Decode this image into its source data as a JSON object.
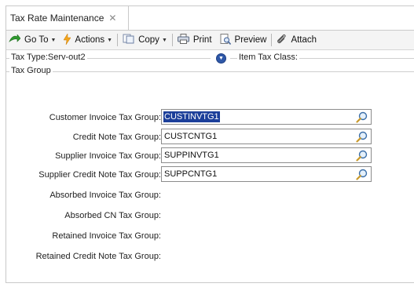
{
  "tab": {
    "title": "Tax Rate Maintenance",
    "close_glyph": "✕"
  },
  "toolbar": {
    "goto_label": "Go To",
    "actions_label": "Actions",
    "copy_label": "Copy",
    "print_label": "Print",
    "preview_label": "Preview",
    "attach_label": "Attach"
  },
  "header": {
    "tax_type_label": "Tax Type:",
    "tax_type_value": "Serv-out2",
    "item_tax_class_label": "Item Tax Class:"
  },
  "tax_group": {
    "section_label": "Tax Group",
    "rows": [
      {
        "label": "Customer Invoice Tax Group:",
        "value": "CUSTINVTG1",
        "selected": true
      },
      {
        "label": "Credit Note Tax Group:",
        "value": "CUSTCNTG1"
      },
      {
        "label": "Supplier Invoice Tax Group:",
        "value": "SUPPINVTG1"
      },
      {
        "label": "Supplier Credit Note Tax Group:",
        "value": "SUPPCNTG1"
      }
    ],
    "static_rows": [
      {
        "label": "Absorbed Invoice Tax Group:"
      },
      {
        "label": "Absorbed CN Tax Group:"
      },
      {
        "label": "Retained Invoice Tax Group:"
      },
      {
        "label": "Retained Credit Note Tax Group:"
      }
    ]
  },
  "colors": {
    "selection": "#1c3f9a",
    "expand_button": "#2f58a8"
  },
  "icons": {
    "goto": "green-arrow-icon",
    "actions": "lightning-icon",
    "copy": "copy-icon",
    "print": "printer-icon",
    "preview": "preview-icon",
    "attach": "paperclip-icon",
    "lookup": "magnifier-icon",
    "expand": "expand-chevron-icon"
  }
}
